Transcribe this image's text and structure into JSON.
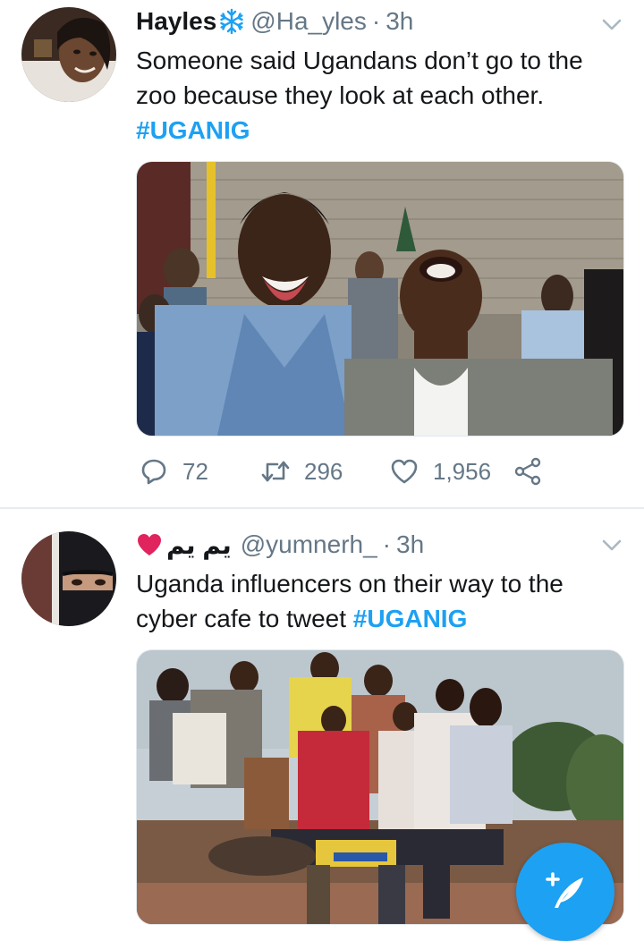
{
  "tweets": [
    {
      "display_name": "Hayles",
      "badge_icon": "snowflake-icon",
      "handle": "@Ha_yles",
      "separator": "·",
      "time": "3h",
      "text_lines": [
        "Someone said Ugandans don’t go to the",
        "zoo because they look at each other."
      ],
      "hashtag": "#UGANIG",
      "actions": {
        "replies": "72",
        "retweets": "296",
        "likes": "1,956"
      },
      "image_subject": "photo"
    },
    {
      "display_name": "يم يم",
      "badge_icon": "heart-icon",
      "badge_color": "#e0245e",
      "handle": "@yumnerh_",
      "separator": "·",
      "time": "3h",
      "text_line1": "Uganda influencers on their way to the",
      "text_line2": "cyber cafe to tweet ",
      "hashtag": "#UGANIG",
      "image_subject": "photo"
    }
  ],
  "colors": {
    "accent": "#1da1f2",
    "secondary_text": "#657786",
    "primary_text": "#14171a",
    "divider": "#e6ecf0"
  },
  "fab": {
    "icon": "compose-feather-icon"
  }
}
